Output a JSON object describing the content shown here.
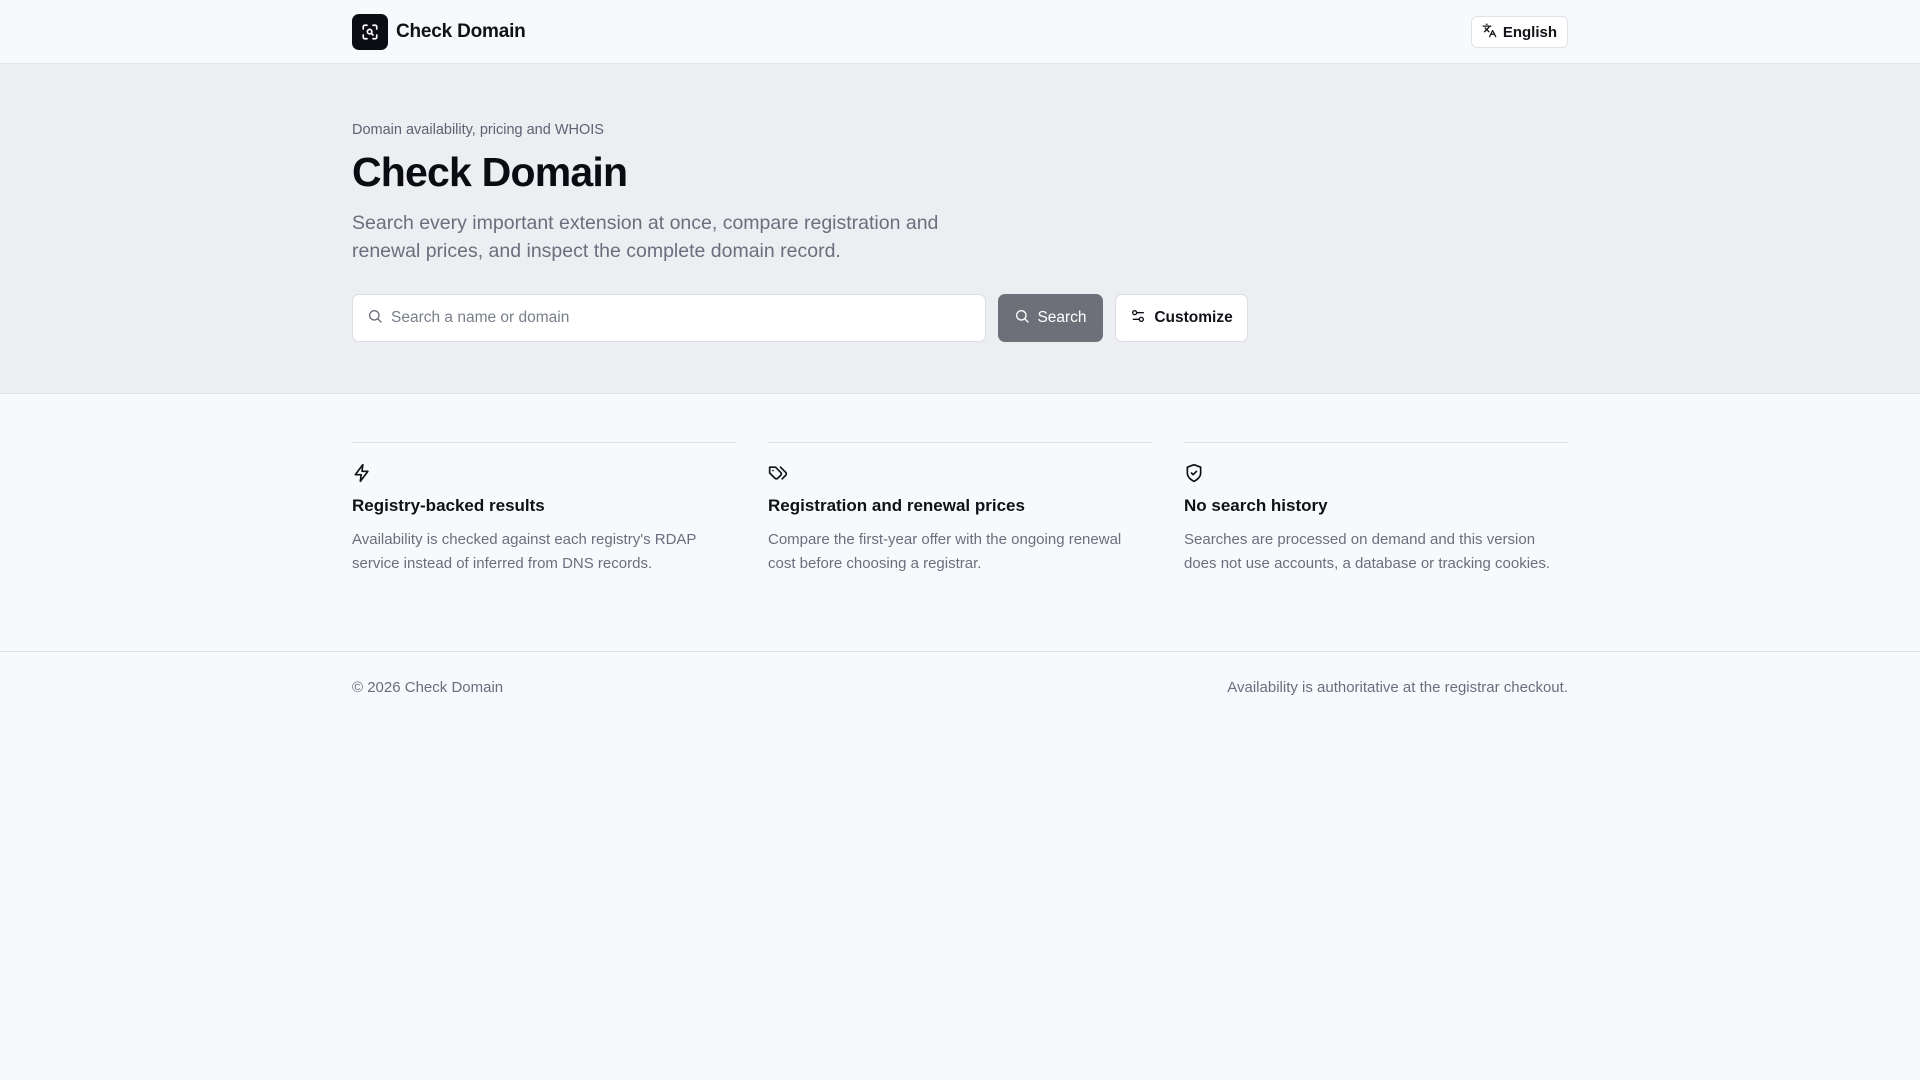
{
  "header": {
    "brand_name": "Check Domain",
    "language_label": "English"
  },
  "hero": {
    "eyebrow": "Domain availability, pricing and WHOIS",
    "title": "Check Domain",
    "subtitle": "Search every important extension at once, compare registration and renewal prices, and inspect the complete domain record.",
    "search_placeholder": "Search a name or domain",
    "search_value": "",
    "search_button": "Search",
    "customize_button": "Customize"
  },
  "features": [
    {
      "icon": "lightning-icon",
      "title": "Registry-backed results",
      "description": "Availability is checked against each registry's RDAP service instead of inferred from DNS records."
    },
    {
      "icon": "tag-icon",
      "title": "Registration and renewal prices",
      "description": "Compare the first-year offer with the ongoing renewal cost before choosing a registrar."
    },
    {
      "icon": "shield-check-icon",
      "title": "No search history",
      "description": "Searches are processed on demand and this version does not use accounts, a database or tracking cookies."
    }
  ],
  "footer": {
    "copyright": "© 2026 Check Domain",
    "note": "Availability is authoritative at the registrar checkout."
  },
  "colors": {
    "background": "#f8f9fc",
    "hero_background": "#edeef2",
    "brand_logo": "#0c0d14",
    "search_button": "#6e7079",
    "muted_text": "#6b6f7d"
  }
}
